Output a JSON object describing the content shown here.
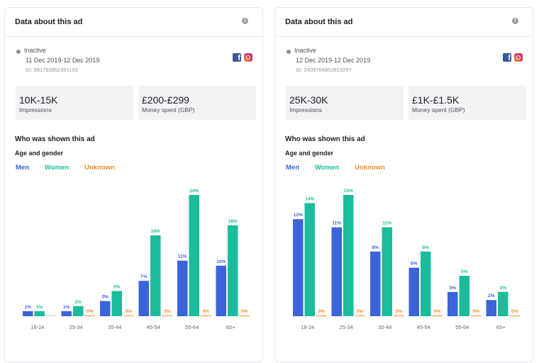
{
  "colors": {
    "men": "#3a64d8",
    "women": "#1abc9c",
    "unknown": "#f28b2b"
  },
  "ads": [
    {
      "header_title": "Data about this ad",
      "status": "Inactive",
      "dates": "11 Dec 2019-12 Dec 2019",
      "id": "ID: 581793852391193",
      "impressions_value": "10K-15K",
      "impressions_label": "Impressions",
      "spend_value": "£200-£299",
      "spend_label": "Money spent (GBP)",
      "section_title": "Who was shown this ad",
      "subsection_title": "Age and gender",
      "legend": [
        "Men",
        "Women",
        "Unknown"
      ]
    },
    {
      "header_title": "Data about this ad",
      "status": "Inactive",
      "dates": "12 Dec 2019-12 Dec 2019",
      "id": "ID: 2409704852613297",
      "impressions_value": "25K-30K",
      "impressions_label": "Impressions",
      "spend_value": "£1K-£1.5K",
      "spend_label": "Money spent (GBP)",
      "section_title": "Who was shown this ad",
      "subsection_title": "Age and gender",
      "legend": [
        "Men",
        "Women",
        "Unknown"
      ]
    }
  ],
  "chart_data": [
    {
      "type": "bar",
      "title": "Age and gender",
      "categories": [
        "18-24",
        "25-34",
        "35-44",
        "45-54",
        "55-64",
        "65+"
      ],
      "series": [
        {
          "name": "Men",
          "values": [
            1,
            1,
            3,
            7,
            11,
            10
          ]
        },
        {
          "name": "Women",
          "values": [
            1,
            2,
            5,
            16,
            24,
            18
          ]
        },
        {
          "name": "Unknown",
          "values": [
            null,
            0,
            0,
            0,
            0,
            0
          ]
        }
      ],
      "value_suffix": "%",
      "ylim": [
        0,
        24
      ],
      "grid": false,
      "legend": "top-left"
    },
    {
      "type": "bar",
      "title": "Age and gender",
      "categories": [
        "18-24",
        "25-34",
        "35-44",
        "45-54",
        "55-64",
        "65+"
      ],
      "series": [
        {
          "name": "Men",
          "values": [
            12,
            11,
            8,
            6,
            3,
            2
          ]
        },
        {
          "name": "Women",
          "values": [
            14,
            15,
            11,
            8,
            5,
            3
          ]
        },
        {
          "name": "Unknown",
          "values": [
            0,
            0,
            0,
            0,
            0,
            0
          ]
        }
      ],
      "value_suffix": "%",
      "ylim": [
        0,
        15
      ],
      "grid": false,
      "legend": "top-left"
    }
  ]
}
